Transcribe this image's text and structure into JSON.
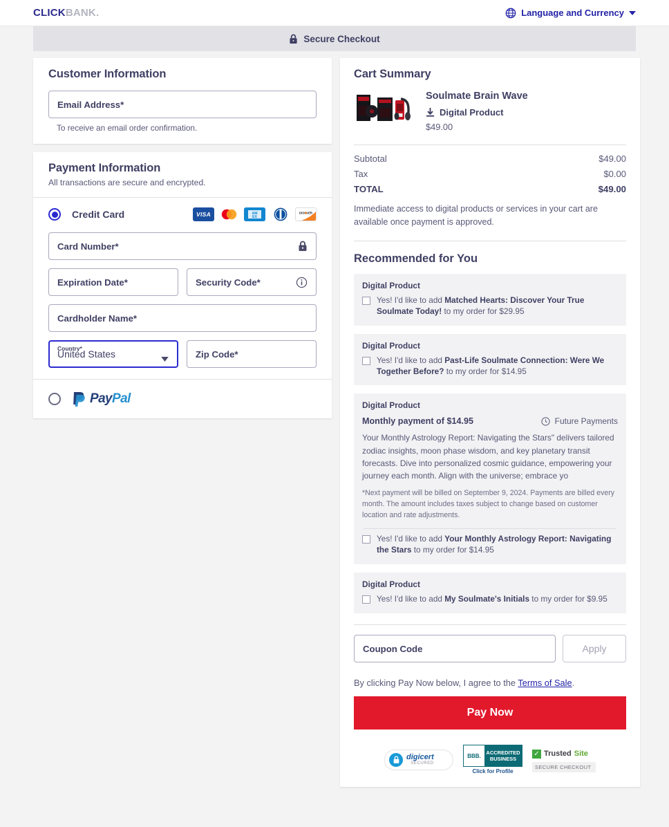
{
  "header": {
    "logo_click": "CLICK",
    "logo_bank": "BANK.",
    "language_label": "Language and Currency",
    "globe_icon": "globe-icon",
    "caret_icon": "chevron-down-icon"
  },
  "secure_bar": {
    "label": "Secure Checkout",
    "lock_icon": "lock-icon"
  },
  "customer_information": {
    "title": "Customer Information",
    "email_placeholder": "Email Address*",
    "email_value": "",
    "helper": "To receive an email order confirmation."
  },
  "payment_information": {
    "title": "Payment Information",
    "subtitle": "All transactions are secure and encrypted.",
    "credit_card_label": "Credit Card",
    "credit_card_selected": true,
    "card_brands": [
      "VISA",
      "mastercard",
      "AMEX",
      "Diners Club",
      "DISCOVER"
    ],
    "card_number_placeholder": "Card Number*",
    "card_number_value": "",
    "lock_icon": "lock-icon",
    "expiration_placeholder": "Expiration Date*",
    "expiration_value": "",
    "security_code_placeholder": "Security Code*",
    "security_code_value": "",
    "info_icon": "info-circle-icon",
    "cardholder_placeholder": "Cardholder Name*",
    "cardholder_value": "",
    "country_label": "Country*",
    "country_value": "United States",
    "country_caret_icon": "chevron-down-icon",
    "zip_placeholder": "Zip Code*",
    "zip_value": "",
    "paypal_label": "PayPal",
    "paypal_pay": "Pay",
    "paypal_pal": "Pal",
    "paypal_selected": false
  },
  "cart_summary": {
    "title": "Cart Summary",
    "product_name": "Soulmate Brain Wave",
    "product_type": "Digital Product",
    "download_icon": "download-icon",
    "product_price": "$49.00",
    "subtotal_label": "Subtotal",
    "subtotal_value": "$49.00",
    "tax_label": "Tax",
    "tax_value": "$0.00",
    "total_label": "TOTAL",
    "total_value": "$49.00",
    "access_note": "Immediate access to digital products or services in your cart are available once payment is approved."
  },
  "recommended": {
    "title": "Recommended for You",
    "items": [
      {
        "tag": "Digital Product",
        "prefix": "Yes! I'd like to add ",
        "name": "Matched Hearts: Discover Your True Soulmate Today!",
        "suffix": " to my order for $29.95",
        "checked": false
      },
      {
        "tag": "Digital Product",
        "prefix": "Yes! I'd like to add ",
        "name": "Past-Life Soulmate Connection: Were We Together Before?",
        "suffix": " to my order for $14.95",
        "checked": false
      },
      {
        "tag": "Digital Product",
        "monthly_label": "Monthly payment of $14.95",
        "future_payments_label": "Future Payments",
        "clock_icon": "clock-icon",
        "description": "Your Monthly Astrology Report: Navigating the Stars\" delivers tailored zodiac insights, moon phase wisdom, and key planetary transit forecasts. Dive into personalized cosmic guidance, empowering your journey each month. Align with the universe; embrace yo",
        "fine_print": "*Next payment will be billed on September 9, 2024. Payments are billed every month. The amount includes taxes subject to change based on customer location and rate adjustments.",
        "prefix": "Yes! I'd like to add ",
        "name": "Your Monthly Astrology Report: Navigating the Stars",
        "suffix": " to my order for $14.95",
        "checked": false
      },
      {
        "tag": "Digital Product",
        "prefix": "Yes! I'd like to add ",
        "name": "My Soulmate's Initials",
        "suffix": " to my order for $9.95",
        "checked": false
      }
    ]
  },
  "coupon": {
    "placeholder": "Coupon Code",
    "value": "",
    "apply_label": "Apply"
  },
  "footer": {
    "terms_prefix": "By clicking Pay Now below, I agree to the ",
    "terms_link": "Terms of Sale",
    "terms_suffix": ".",
    "pay_now_label": "Pay Now",
    "badges": {
      "digicert_name": "digicert",
      "digicert_sub": "SECURED",
      "bbb_abbr": "BBB.",
      "bbb_line1": "ACCREDITED",
      "bbb_line2": "BUSINESS",
      "bbb_caption": "Click for Profile",
      "trusted_t1": "Trusted",
      "trusted_t2": "Site",
      "trusted_sub": "SECURE CHECKOUT"
    }
  },
  "colors": {
    "accent_blue": "#2323a8",
    "pay_now_red": "#e2182b",
    "text": "#3f3f63",
    "muted": "#585878",
    "panel_gray": "#f2f2f4"
  }
}
